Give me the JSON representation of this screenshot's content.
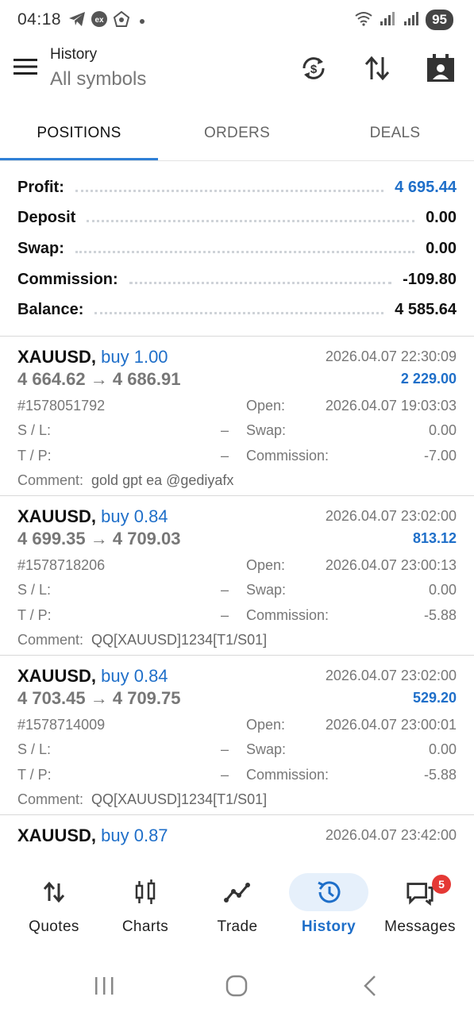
{
  "status_bar": {
    "time": "04:18",
    "battery": "95",
    "icons": [
      "telegram-icon",
      "ex-app-icon",
      "sync-icon",
      "dot-icon",
      "wifi-icon",
      "signal-icon",
      "signal-r-icon"
    ]
  },
  "appbar": {
    "title": "History",
    "subtitle": "All symbols",
    "icons": [
      "menu-icon",
      "currency-sync-icon",
      "sort-icon",
      "calendar-icon"
    ]
  },
  "tabs": [
    {
      "label": "POSITIONS",
      "active": true
    },
    {
      "label": "ORDERS",
      "active": false
    },
    {
      "label": "DEALS",
      "active": false
    }
  ],
  "summary": [
    {
      "label": "Profit:",
      "value": "4 695.44",
      "highlight": true
    },
    {
      "label": "Deposit",
      "value": "0.00",
      "highlight": false
    },
    {
      "label": "Swap:",
      "value": "0.00",
      "highlight": false
    },
    {
      "label": "Commission:",
      "value": "-109.80",
      "highlight": false
    },
    {
      "label": "Balance:",
      "value": "4 585.64",
      "highlight": false
    }
  ],
  "positions": [
    {
      "symbol": "XAUUSD,",
      "side": "buy 1.00",
      "close_time": "2026.04.07 22:30:09",
      "prices": "4 664.62 → 4 686.91",
      "profit": "2 229.00",
      "ticket": "#1578051792",
      "open_label": "Open:",
      "open_time": "2026.04.07 19:03:03",
      "sl_label": "S / L:",
      "sl": "–",
      "swap_label": "Swap:",
      "swap": "0.00",
      "tp_label": "T / P:",
      "tp": "–",
      "commission_label": "Commission:",
      "commission": "-7.00",
      "comment_label": "Comment:",
      "comment": "gold gpt ea @gediyafx"
    },
    {
      "symbol": "XAUUSD,",
      "side": "buy 0.84",
      "close_time": "2026.04.07 23:02:00",
      "prices": "4 699.35 → 4 709.03",
      "profit": "813.12",
      "ticket": "#1578718206",
      "open_label": "Open:",
      "open_time": "2026.04.07 23:00:13",
      "sl_label": "S / L:",
      "sl": "–",
      "swap_label": "Swap:",
      "swap": "0.00",
      "tp_label": "T / P:",
      "tp": "–",
      "commission_label": "Commission:",
      "commission": "-5.88",
      "comment_label": "Comment:",
      "comment": "QQ[XAUUSD]1234[T1/S01]"
    },
    {
      "symbol": "XAUUSD,",
      "side": "buy 0.84",
      "close_time": "2026.04.07 23:02:00",
      "prices": "4 703.45 → 4 709.75",
      "profit": "529.20",
      "ticket": "#1578714009",
      "open_label": "Open:",
      "open_time": "2026.04.07 23:00:01",
      "sl_label": "S / L:",
      "sl": "–",
      "swap_label": "Swap:",
      "swap": "0.00",
      "tp_label": "T / P:",
      "tp": "–",
      "commission_label": "Commission:",
      "commission": "-5.88",
      "comment_label": "Comment:",
      "comment": "QQ[XAUUSD]1234[T1/S01]"
    },
    {
      "symbol": "XAUUSD,",
      "side": "buy 0.87",
      "close_time": "2026.04.07 23:42:00"
    }
  ],
  "bottom_nav": [
    {
      "label": "Quotes",
      "icon": "quotes-icon",
      "active": false
    },
    {
      "label": "Charts",
      "icon": "charts-icon",
      "active": false
    },
    {
      "label": "Trade",
      "icon": "trade-icon",
      "active": false
    },
    {
      "label": "History",
      "icon": "history-icon",
      "active": true
    },
    {
      "label": "Messages",
      "icon": "messages-icon",
      "active": false,
      "badge": "5"
    }
  ],
  "colors": {
    "accent": "#1f6fc9",
    "tab_indicator": "#2f7fd6",
    "active_nav_bg": "#e6f0fb",
    "badge": "#e53935"
  }
}
